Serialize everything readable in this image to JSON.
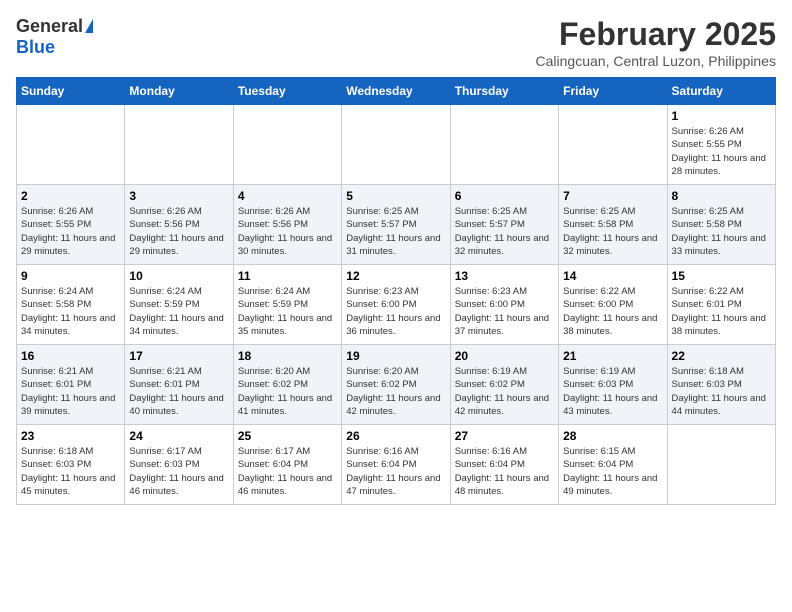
{
  "header": {
    "logo_general": "General",
    "logo_blue": "Blue",
    "month_year": "February 2025",
    "location": "Calingcuan, Central Luzon, Philippines"
  },
  "days_of_week": [
    "Sunday",
    "Monday",
    "Tuesday",
    "Wednesday",
    "Thursday",
    "Friday",
    "Saturday"
  ],
  "weeks": [
    [
      {
        "day": "",
        "info": ""
      },
      {
        "day": "",
        "info": ""
      },
      {
        "day": "",
        "info": ""
      },
      {
        "day": "",
        "info": ""
      },
      {
        "day": "",
        "info": ""
      },
      {
        "day": "",
        "info": ""
      },
      {
        "day": "1",
        "info": "Sunrise: 6:26 AM\nSunset: 5:55 PM\nDaylight: 11 hours and 28 minutes."
      }
    ],
    [
      {
        "day": "2",
        "info": "Sunrise: 6:26 AM\nSunset: 5:55 PM\nDaylight: 11 hours and 29 minutes."
      },
      {
        "day": "3",
        "info": "Sunrise: 6:26 AM\nSunset: 5:56 PM\nDaylight: 11 hours and 29 minutes."
      },
      {
        "day": "4",
        "info": "Sunrise: 6:26 AM\nSunset: 5:56 PM\nDaylight: 11 hours and 30 minutes."
      },
      {
        "day": "5",
        "info": "Sunrise: 6:25 AM\nSunset: 5:57 PM\nDaylight: 11 hours and 31 minutes."
      },
      {
        "day": "6",
        "info": "Sunrise: 6:25 AM\nSunset: 5:57 PM\nDaylight: 11 hours and 32 minutes."
      },
      {
        "day": "7",
        "info": "Sunrise: 6:25 AM\nSunset: 5:58 PM\nDaylight: 11 hours and 32 minutes."
      },
      {
        "day": "8",
        "info": "Sunrise: 6:25 AM\nSunset: 5:58 PM\nDaylight: 11 hours and 33 minutes."
      }
    ],
    [
      {
        "day": "9",
        "info": "Sunrise: 6:24 AM\nSunset: 5:58 PM\nDaylight: 11 hours and 34 minutes."
      },
      {
        "day": "10",
        "info": "Sunrise: 6:24 AM\nSunset: 5:59 PM\nDaylight: 11 hours and 34 minutes."
      },
      {
        "day": "11",
        "info": "Sunrise: 6:24 AM\nSunset: 5:59 PM\nDaylight: 11 hours and 35 minutes."
      },
      {
        "day": "12",
        "info": "Sunrise: 6:23 AM\nSunset: 6:00 PM\nDaylight: 11 hours and 36 minutes."
      },
      {
        "day": "13",
        "info": "Sunrise: 6:23 AM\nSunset: 6:00 PM\nDaylight: 11 hours and 37 minutes."
      },
      {
        "day": "14",
        "info": "Sunrise: 6:22 AM\nSunset: 6:00 PM\nDaylight: 11 hours and 38 minutes."
      },
      {
        "day": "15",
        "info": "Sunrise: 6:22 AM\nSunset: 6:01 PM\nDaylight: 11 hours and 38 minutes."
      }
    ],
    [
      {
        "day": "16",
        "info": "Sunrise: 6:21 AM\nSunset: 6:01 PM\nDaylight: 11 hours and 39 minutes."
      },
      {
        "day": "17",
        "info": "Sunrise: 6:21 AM\nSunset: 6:01 PM\nDaylight: 11 hours and 40 minutes."
      },
      {
        "day": "18",
        "info": "Sunrise: 6:20 AM\nSunset: 6:02 PM\nDaylight: 11 hours and 41 minutes."
      },
      {
        "day": "19",
        "info": "Sunrise: 6:20 AM\nSunset: 6:02 PM\nDaylight: 11 hours and 42 minutes."
      },
      {
        "day": "20",
        "info": "Sunrise: 6:19 AM\nSunset: 6:02 PM\nDaylight: 11 hours and 42 minutes."
      },
      {
        "day": "21",
        "info": "Sunrise: 6:19 AM\nSunset: 6:03 PM\nDaylight: 11 hours and 43 minutes."
      },
      {
        "day": "22",
        "info": "Sunrise: 6:18 AM\nSunset: 6:03 PM\nDaylight: 11 hours and 44 minutes."
      }
    ],
    [
      {
        "day": "23",
        "info": "Sunrise: 6:18 AM\nSunset: 6:03 PM\nDaylight: 11 hours and 45 minutes."
      },
      {
        "day": "24",
        "info": "Sunrise: 6:17 AM\nSunset: 6:03 PM\nDaylight: 11 hours and 46 minutes."
      },
      {
        "day": "25",
        "info": "Sunrise: 6:17 AM\nSunset: 6:04 PM\nDaylight: 11 hours and 46 minutes."
      },
      {
        "day": "26",
        "info": "Sunrise: 6:16 AM\nSunset: 6:04 PM\nDaylight: 11 hours and 47 minutes."
      },
      {
        "day": "27",
        "info": "Sunrise: 6:16 AM\nSunset: 6:04 PM\nDaylight: 11 hours and 48 minutes."
      },
      {
        "day": "28",
        "info": "Sunrise: 6:15 AM\nSunset: 6:04 PM\nDaylight: 11 hours and 49 minutes."
      },
      {
        "day": "",
        "info": ""
      }
    ]
  ]
}
